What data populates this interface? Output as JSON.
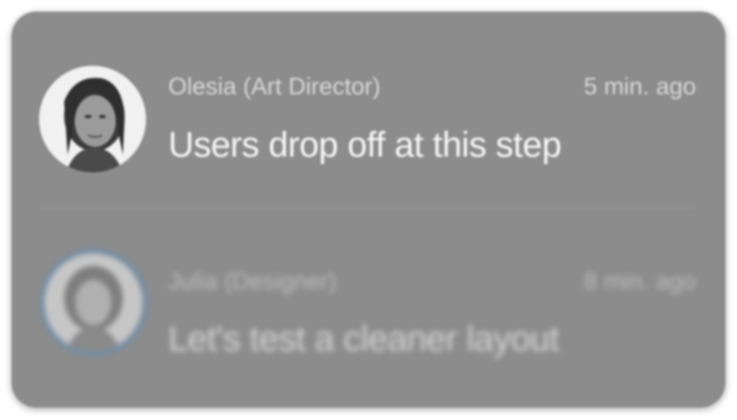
{
  "notifications": [
    {
      "sender": "Olesia (Art Director)",
      "time": "5 min. ago",
      "message": "Users drop off at this step",
      "avatar_icon": "portrait-photo"
    },
    {
      "sender": "Julia (Designer)",
      "time": "8 min. ago",
      "message": "Let's test a cleaner layout",
      "avatar_icon": "portrait-photo"
    }
  ],
  "colors": {
    "card_background": "#8c8c8c",
    "avatar_ring": "#6f8da6"
  }
}
